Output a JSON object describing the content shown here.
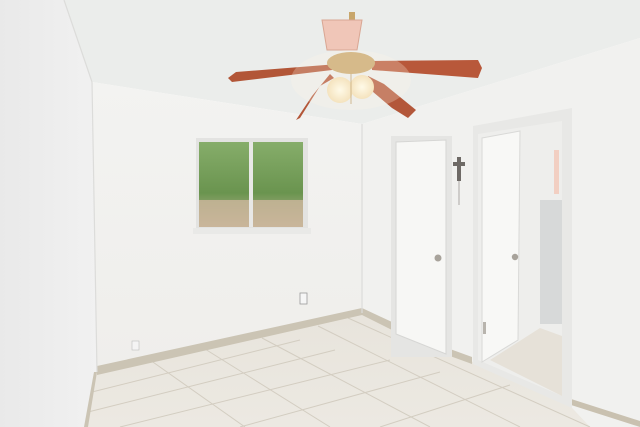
{
  "scene": {
    "subject": "empty bedroom",
    "features": [
      "ceiling-fan",
      "window",
      "closet-door",
      "open-door",
      "tile-floor",
      "wall-cross"
    ]
  },
  "colors": {
    "ceiling": "#eceeec",
    "left_wall": "#eeeeee",
    "back_wall": "#f3f3f1",
    "right_wall": "#f1f1ef",
    "floor": "#e6e1d8",
    "grout": "#cfc9bd",
    "baseboard": "#c9c2b3",
    "fan_blade": "#b5573a",
    "fan_brass": "#c8a66b",
    "window_foliage": "#6f9a55",
    "door": "#f7f7f5"
  }
}
